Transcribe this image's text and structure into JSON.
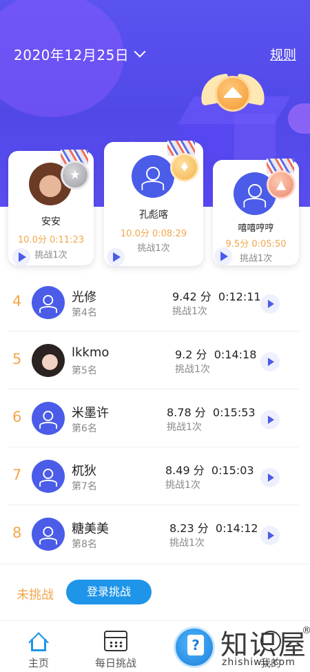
{
  "header": {
    "date": "2020年12月25日",
    "rules_label": "规则"
  },
  "podium": {
    "first": {
      "name": "孔彪喀",
      "score": "10.0分",
      "time": "0:08:29",
      "tries": "挑战1次"
    },
    "second": {
      "name": "安安",
      "score": "10.0分",
      "time": "0:11:23",
      "tries": "挑战1次"
    },
    "third": {
      "name": "嘻嘻哼哼",
      "score": "9.5分",
      "time": "0:05:50",
      "tries": "挑战1次"
    }
  },
  "list": [
    {
      "rank": "4",
      "name": "光修",
      "place": "第4名",
      "score": "9.42 分",
      "time": "0:12:11",
      "tries": "挑战1次"
    },
    {
      "rank": "5",
      "name": "lkkmo",
      "place": "第5名",
      "score": "9.2 分",
      "time": "0:14:18",
      "tries": "挑战1次"
    },
    {
      "rank": "6",
      "name": "米墨许",
      "place": "第6名",
      "score": "8.78 分",
      "time": "0:15:53",
      "tries": "挑战1次"
    },
    {
      "rank": "7",
      "name": "杌狄",
      "place": "第7名",
      "score": "8.49 分",
      "time": "0:15:03",
      "tries": "挑战1次"
    },
    {
      "rank": "8",
      "name": "糖美美",
      "place": "第8名",
      "score": "8.23 分",
      "time": "0:14:12",
      "tries": "挑战1次"
    }
  ],
  "status": {
    "not_challenged": "未挑战",
    "login_button": "登录挑战"
  },
  "tabs": [
    {
      "label": "主页",
      "icon": "home-icon",
      "active": true
    },
    {
      "label": "每日挑战",
      "icon": "calendar-icon",
      "active": false
    },
    {
      "label": "我的",
      "icon": "profile-icon",
      "active": false
    }
  ],
  "watermark": {
    "text": "知识屋",
    "reg": "®",
    "url": "zhishiwu.com"
  },
  "colors": {
    "header_purple": "#5148e8",
    "score_orange": "#f3a64a",
    "accent_blue": "#1e95e8",
    "avatar_blue": "#4a5ce8"
  }
}
